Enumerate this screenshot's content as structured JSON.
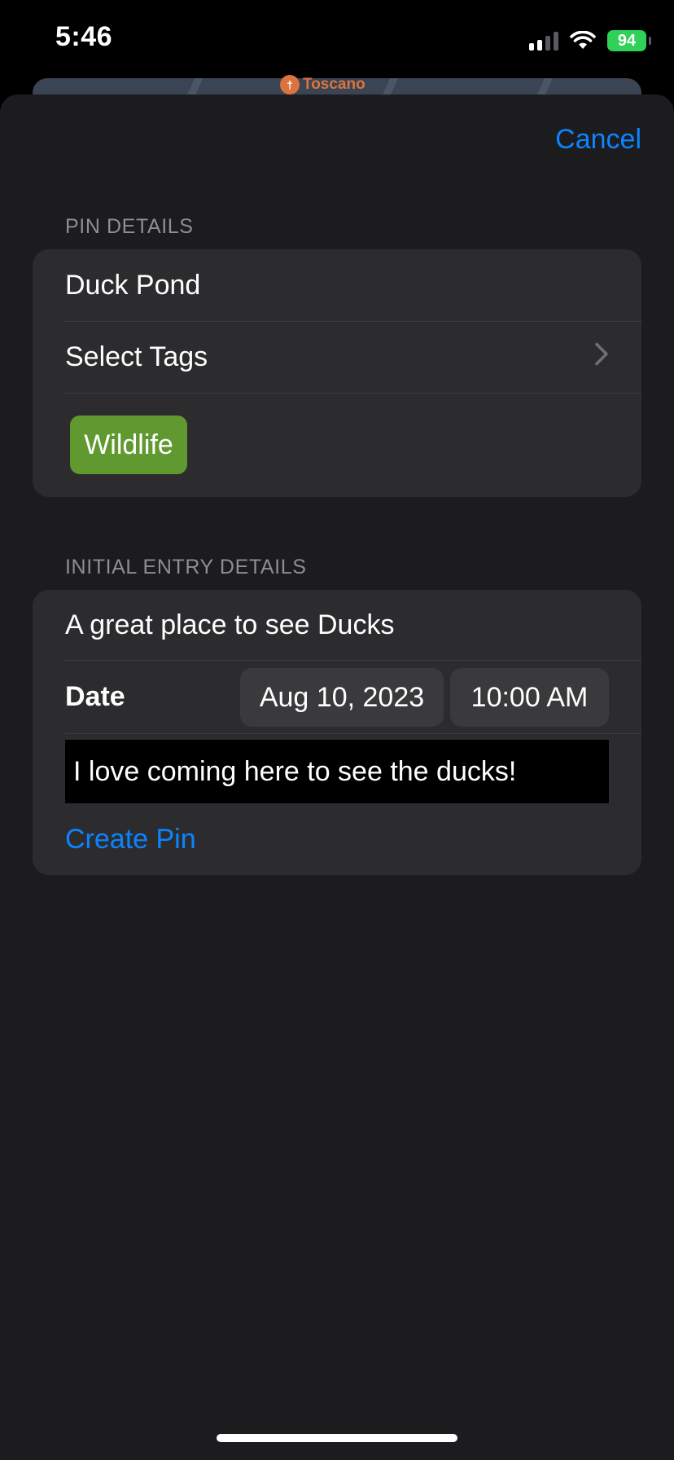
{
  "status_bar": {
    "time": "5:46",
    "battery_percent": "94",
    "cellular_icon": "cellular-signal-icon",
    "wifi_icon": "wifi-icon"
  },
  "map_preview": {
    "place_label": "Toscano",
    "place_icon": "restaurant-icon"
  },
  "sheet": {
    "cancel_label": "Cancel"
  },
  "pin_details": {
    "header": "PIN DETAILS",
    "name_value": "Duck Pond",
    "select_tags_label": "Select Tags",
    "chevron_icon": "chevron-right-icon",
    "tags": [
      {
        "label": "Wildlife",
        "color": "#5f9930"
      }
    ]
  },
  "initial_entry": {
    "header": "INITIAL ENTRY DETAILS",
    "title_value": "A great place to see Ducks",
    "date_label": "Date",
    "date_value": "Aug 10, 2023",
    "time_value": "10:00 AM",
    "notes_value": "I love coming here to see the ducks!"
  },
  "actions": {
    "create_pin_label": "Create Pin"
  },
  "colors": {
    "accent": "#0a84ff",
    "sheet_background": "#1c1c1e",
    "group_background": "#2c2c2e",
    "tag_wildlife": "#5f9930"
  }
}
